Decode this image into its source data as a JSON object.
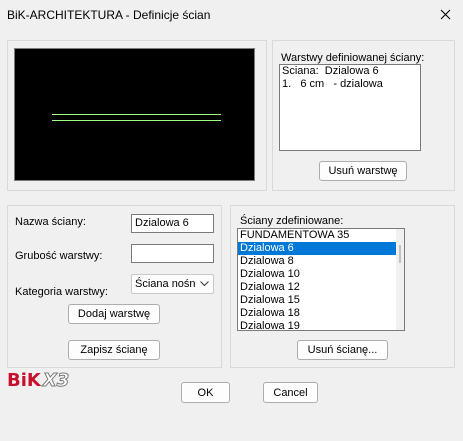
{
  "window": {
    "title": "BiK-ARCHITEKTURA - Definicje ścian",
    "close_icon": "close-icon"
  },
  "preview": {
    "background": "#000000",
    "line_color": "#9cff7f"
  },
  "layers": {
    "group_label": "Warstwy definiowanej ściany:",
    "rows": [
      "Sciana:  Dzialowa 6",
      "1.   6 cm   - dzialowa"
    ],
    "remove_button": "Usuń warstwę"
  },
  "form": {
    "name_label": "Nazwa ściany:",
    "name_value": "Dzialowa 6",
    "thickness_label": "Grubość warstwy:",
    "thickness_value": "",
    "category_label": "Kategoria warstwy:",
    "category_value": "Ściana nośn",
    "add_button": "Dodaj warstwę",
    "save_button": "Zapisz ścianę"
  },
  "defined": {
    "group_label": "Ściany zdefiniowane:",
    "items": [
      "FUNDAMENTOWA 35",
      "Dzialowa 6",
      "Dzialowa 8",
      "Dzialowa 10",
      "Dzialowa 12",
      "Dzialowa 15",
      "Dzialowa 18",
      "Dzialowa 19"
    ],
    "selected_index": 1,
    "remove_button": "Usuń ścianę..."
  },
  "footer": {
    "logo_text_1": "BiK",
    "logo_text_2": "X3",
    "ok": "OK",
    "cancel": "Cancel"
  },
  "colors": {
    "selection": "#0078d7",
    "logo_red": "#c8102e"
  }
}
